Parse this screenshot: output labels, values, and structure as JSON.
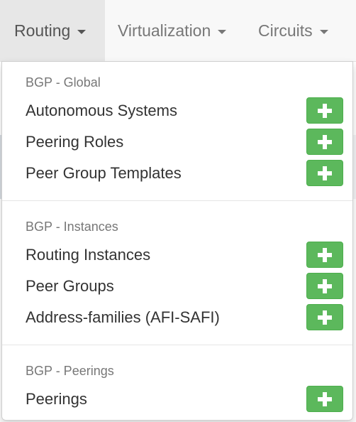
{
  "navbar": {
    "items": [
      {
        "label": "Routing",
        "active": true
      },
      {
        "label": "Virtualization",
        "active": false
      },
      {
        "label": "Circuits",
        "active": false
      }
    ]
  },
  "dropdown": {
    "sections": [
      {
        "header": "BGP - Global",
        "items": [
          {
            "label": "Autonomous Systems"
          },
          {
            "label": "Peering Roles"
          },
          {
            "label": "Peer Group Templates"
          }
        ]
      },
      {
        "header": "BGP - Instances",
        "items": [
          {
            "label": "Routing Instances"
          },
          {
            "label": "Peer Groups"
          },
          {
            "label": "Address-families (AFI-SAFI)"
          }
        ]
      },
      {
        "header": "BGP - Peerings",
        "items": [
          {
            "label": "Peerings"
          }
        ]
      }
    ]
  },
  "colors": {
    "add_button": "#5cb85c",
    "nav_active_bg": "#e7e7e7",
    "text": "#333333",
    "muted": "#777777"
  },
  "icons": {
    "add": "plus-icon",
    "dropdown_caret": "caret-down-icon"
  }
}
